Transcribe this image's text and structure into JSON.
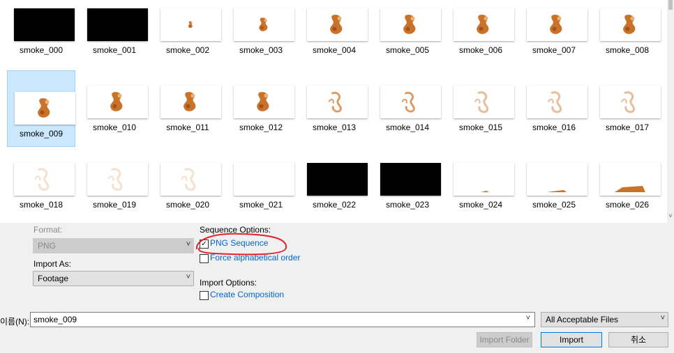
{
  "thumbnails": [
    {
      "name": "smoke_000",
      "kind": "black",
      "stage": 0
    },
    {
      "name": "smoke_001",
      "kind": "black",
      "stage": 0
    },
    {
      "name": "smoke_002",
      "kind": "smoke",
      "stage": 1
    },
    {
      "name": "smoke_003",
      "kind": "smoke",
      "stage": 2
    },
    {
      "name": "smoke_004",
      "kind": "smoke",
      "stage": 3
    },
    {
      "name": "smoke_005",
      "kind": "smoke",
      "stage": 3
    },
    {
      "name": "smoke_006",
      "kind": "smoke",
      "stage": 3
    },
    {
      "name": "smoke_007",
      "kind": "smoke",
      "stage": 3
    },
    {
      "name": "smoke_008",
      "kind": "smoke",
      "stage": 3
    },
    {
      "name": "smoke_009",
      "kind": "smoke",
      "stage": 3,
      "selected": true
    },
    {
      "name": "smoke_010",
      "kind": "smoke",
      "stage": 3
    },
    {
      "name": "smoke_011",
      "kind": "smoke",
      "stage": 3
    },
    {
      "name": "smoke_012",
      "kind": "smoke",
      "stage": 3
    },
    {
      "name": "smoke_013",
      "kind": "smoke",
      "stage": 4
    },
    {
      "name": "smoke_014",
      "kind": "smoke",
      "stage": 4
    },
    {
      "name": "smoke_015",
      "kind": "smoke",
      "stage": 5
    },
    {
      "name": "smoke_016",
      "kind": "smoke",
      "stage": 5
    },
    {
      "name": "smoke_017",
      "kind": "smoke",
      "stage": 5
    },
    {
      "name": "smoke_018",
      "kind": "smoke",
      "stage": 6
    },
    {
      "name": "smoke_019",
      "kind": "smoke",
      "stage": 6
    },
    {
      "name": "smoke_020",
      "kind": "smoke",
      "stage": 6
    },
    {
      "name": "smoke_021",
      "kind": "blank",
      "stage": 0
    },
    {
      "name": "smoke_022",
      "kind": "black",
      "stage": 0
    },
    {
      "name": "smoke_023",
      "kind": "black",
      "stage": 0
    },
    {
      "name": "smoke_024",
      "kind": "ground",
      "stage": 1
    },
    {
      "name": "smoke_025",
      "kind": "ground",
      "stage": 2
    },
    {
      "name": "smoke_026",
      "kind": "ground",
      "stage": 3
    }
  ],
  "scrollbar": {
    "down_arrow": "˅"
  },
  "options": {
    "format_label": "Format:",
    "format_value": "PNG",
    "import_as_label": "Import As:",
    "import_as_value": "Footage",
    "sequence_options_label": "Sequence Options:",
    "png_sequence_label": "PNG Sequence",
    "png_sequence_checked": true,
    "force_alpha_label": "Force alphabetical order",
    "force_alpha_checked": false,
    "import_options_label": "Import Options:",
    "create_comp_label": "Create Composition",
    "create_comp_checked": false
  },
  "footer": {
    "filename_label": "이름(N):",
    "filename_value": "smoke_009",
    "filetype_value": "All Acceptable Files",
    "import_folder_label": "Import Folder",
    "import_label": "Import",
    "cancel_label": "취소"
  },
  "icons": {
    "check": "✓",
    "dropdown": "˅"
  },
  "colors": {
    "selection": "#cce8ff",
    "link": "#0066cc",
    "annotation": "#e0202a",
    "smoke": "#c9732a"
  }
}
